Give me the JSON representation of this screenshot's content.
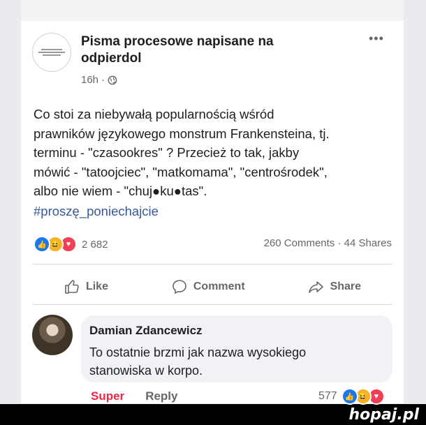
{
  "post": {
    "page_name": "Pisma procesowe napisane na odpierdol",
    "time": "16h",
    "separator": "·",
    "text_lines": [
      "Co stoi za niebywałą popularnością wśród",
      "prawników językowego monstrum Frankensteina, tj.",
      "terminu - \"czasookres\" ? Przecież to tak, jakby",
      "mówić - \"tatoojciec\", \"matkomama\", \"centrośrodek\",",
      "albo nie wiem - \"chuj●ku●tas\"."
    ],
    "hashtag": "#proszę_poniechajcie",
    "reactions_count": "2 682",
    "stats": "260 Comments · 44 Shares"
  },
  "actions": {
    "like": "Like",
    "comment": "Comment",
    "share": "Share"
  },
  "comment": {
    "author": "Damian Zdancewicz",
    "text_lines": [
      "To ostatnie brzmi jak nazwa wysokiego",
      "stanowiska w korpo."
    ],
    "super_label": "Super",
    "reply_label": "Reply",
    "reactions_count": "577"
  },
  "watermark": "hopaj.pl",
  "colors": {
    "like_blue": "#1877f2",
    "haha_yellow": "#f7b125",
    "love_red": "#f33e58",
    "hashtag": "#385898",
    "super": "#f0284a"
  }
}
